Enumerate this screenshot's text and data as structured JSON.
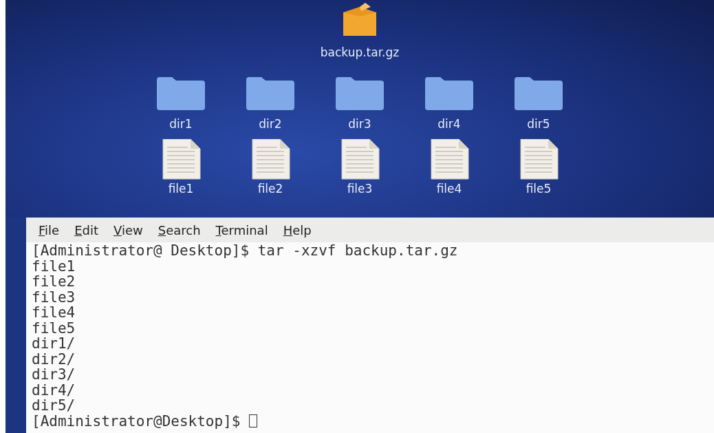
{
  "desktop": {
    "archive": {
      "label": "backup.tar.gz"
    },
    "folders": [
      {
        "label": "dir1"
      },
      {
        "label": "dir2"
      },
      {
        "label": "dir3"
      },
      {
        "label": "dir4"
      },
      {
        "label": "dir5"
      }
    ],
    "files": [
      {
        "label": "file1"
      },
      {
        "label": "file2"
      },
      {
        "label": "file3"
      },
      {
        "label": "file4"
      },
      {
        "label": "file5"
      }
    ]
  },
  "terminal": {
    "menu": [
      {
        "label": "File"
      },
      {
        "label": "Edit"
      },
      {
        "label": "View"
      },
      {
        "label": "Search"
      },
      {
        "label": "Terminal"
      },
      {
        "label": "Help"
      }
    ],
    "lines": [
      "[Administrator@ Desktop]$ tar -xzvf backup.tar.gz",
      "file1",
      "file2",
      "file3",
      "file4",
      "file5",
      "dir1/",
      "dir2/",
      "dir3/",
      "dir4/",
      "dir5/"
    ],
    "prompt": "[Administrator@Desktop]$ "
  }
}
